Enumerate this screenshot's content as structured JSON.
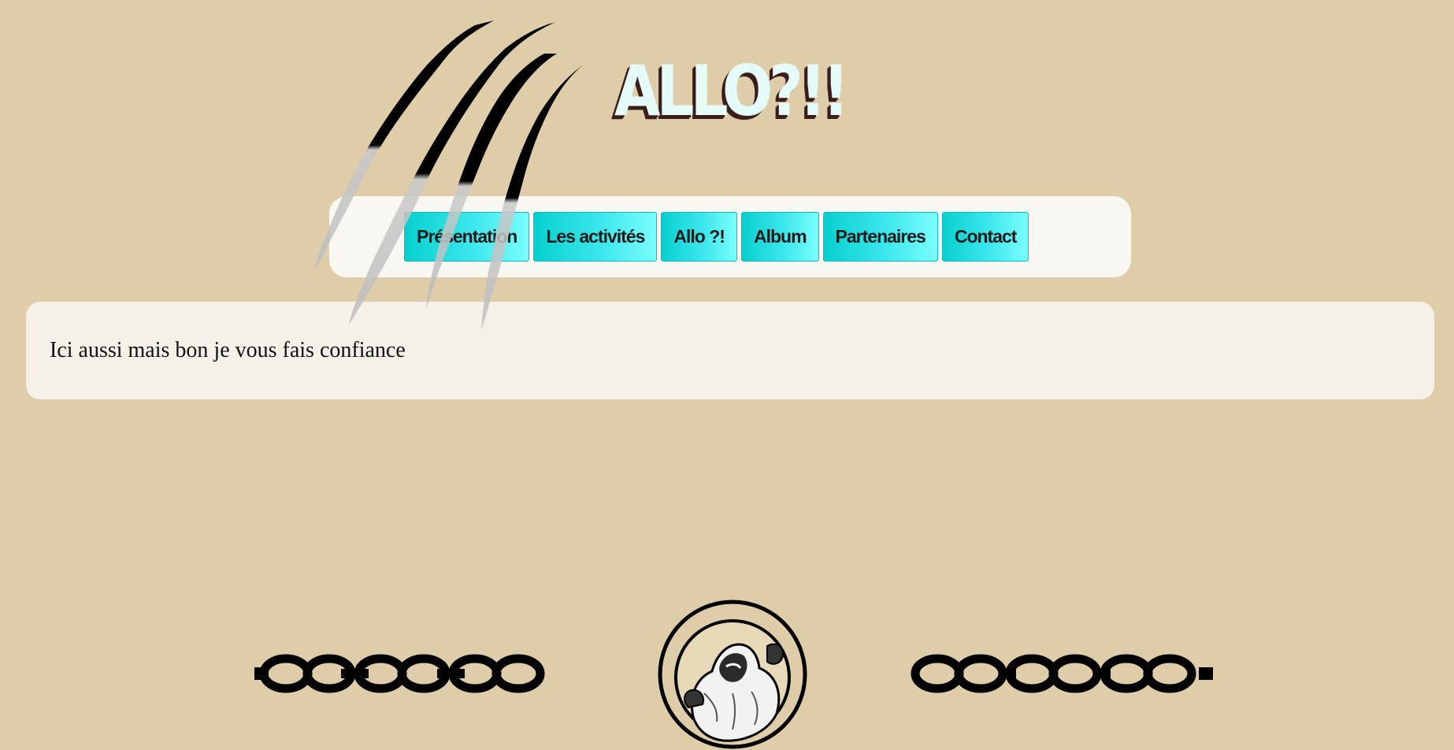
{
  "header": {
    "title": "ALLO?!!"
  },
  "nav": {
    "items": [
      {
        "label": "Présentation"
      },
      {
        "label": "Les activités"
      },
      {
        "label": "Allo ?!"
      },
      {
        "label": "Album"
      },
      {
        "label": "Partenaires"
      },
      {
        "label": "Contact"
      }
    ]
  },
  "main": {
    "text": "Ici aussi mais bon je vous fais confiance"
  },
  "footer": {
    "left_decoration": "chain-icon",
    "logo": "roaring-bear-logo",
    "right_decoration": "chain-icon"
  },
  "decorations": {
    "header_overlay": "claw-marks-icon"
  },
  "colors": {
    "background": "#dfcca8",
    "nav_background": "#f9f7f2",
    "content_background": "#f6f1e8",
    "button_gradient_start": "#08cfcf",
    "button_gradient_end": "#7bfdfd",
    "title_fill": "#e4fbf8",
    "title_shadow": "#3a1e1e"
  }
}
